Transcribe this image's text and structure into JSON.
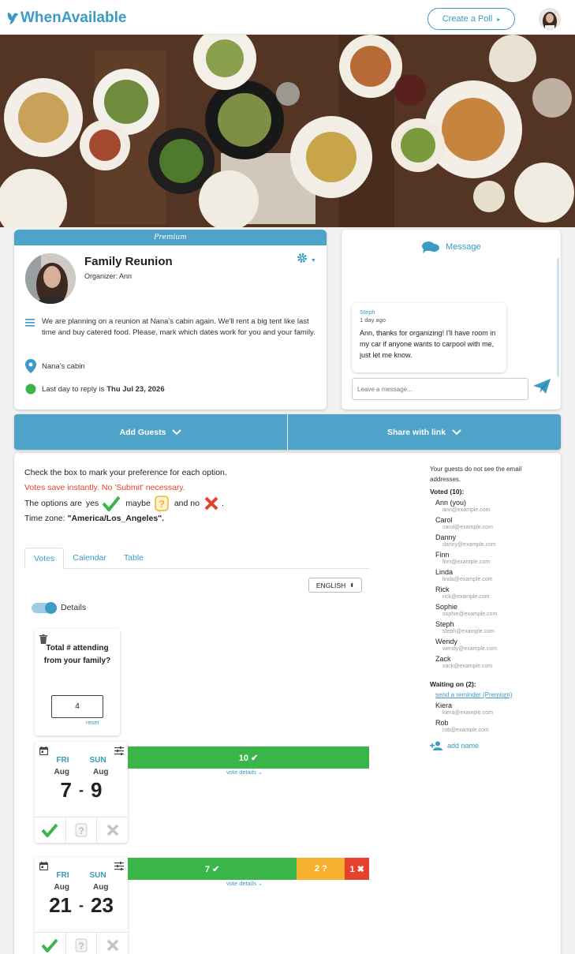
{
  "app": {
    "name": "WhenAvailable",
    "accent": "#3a9bc3"
  },
  "header": {
    "create_poll": "Create a Poll",
    "create_caret": "▸"
  },
  "event": {
    "premium": "Premium",
    "title": "Family Reunion",
    "organizer": "Organizer: Ann",
    "description": "We are planning on a reunion at Nana's cabin again. We'll rent a big tent like last time and buy catered food. Please, mark which dates work for you and your family.",
    "location": "Nana's cabin",
    "deadline_label": "Last day to reply is",
    "deadline_value": "Thu Jul 23, 2026"
  },
  "message": {
    "header": "Message",
    "sender": "Steph",
    "time": "1 day ago",
    "text": "Ann, thanks for organizing! I'll have room in my car if anyone wants to carpool with me, just let me know.",
    "input_placeholder": "Leave a message..."
  },
  "guest_bar": {
    "add_guests": "Add Guests",
    "share_link": "Share with link"
  },
  "instructions": {
    "line1": "Check the box to mark your preference for each option.",
    "line2": "Votes save instantly. No 'Submit' necessary.",
    "options_prefix": "The options are",
    "yes": "yes",
    "maybe": "maybe",
    "and_no": "and no",
    "period": ".",
    "tz_label": "Time zone:",
    "tz_value": "\"America/Los_Angeles\"."
  },
  "tabs": [
    "Votes",
    "Calendar",
    "Table"
  ],
  "language": {
    "value": "ENGLISH",
    "arrow": "⬍"
  },
  "details_toggle": {
    "label": "Details",
    "on": true
  },
  "attendance": {
    "question": "Total # attending from your family?",
    "value": "4",
    "reset": "reset"
  },
  "options": [
    {
      "start_day": "FRI",
      "end_day": "SUN",
      "start_month": "Aug",
      "end_month": "Aug",
      "start_date": "7",
      "end_date": "9",
      "dash": "-",
      "votes": {
        "yes": 10,
        "maybe": 0,
        "no": 0
      },
      "labels": {
        "yes": "10 ✔",
        "maybe": "",
        "no": ""
      },
      "vote_details": "vote details ⌄",
      "my_vote": "yes"
    },
    {
      "start_day": "FRI",
      "end_day": "SUN",
      "start_month": "Aug",
      "end_month": "Aug",
      "start_date": "21",
      "end_date": "23",
      "dash": "-",
      "votes": {
        "yes": 7,
        "maybe": 2,
        "no": 1
      },
      "labels": {
        "yes": "7 ✔",
        "maybe": "2 ?",
        "no": "1 ✖"
      },
      "vote_details": "vote details ⌄",
      "my_vote": "yes"
    }
  ],
  "guests": {
    "note": "Your guests do not see the email addresses.",
    "voted_header": "Voted (10):",
    "voted": [
      {
        "name": "Ann (you)",
        "email": "ann@example.com"
      },
      {
        "name": "Carol",
        "email": "carol@example.com"
      },
      {
        "name": "Danny",
        "email": "danny@example.com"
      },
      {
        "name": "Finn",
        "email": "finn@example.com"
      },
      {
        "name": "Linda",
        "email": "linda@example.com"
      },
      {
        "name": "Rick",
        "email": "rick@example.com"
      },
      {
        "name": "Sophie",
        "email": "sophie@example.com"
      },
      {
        "name": "Steph",
        "email": "steph@example.com"
      },
      {
        "name": "Wendy",
        "email": "wendy@example.com"
      },
      {
        "name": "Zack",
        "email": "zack@example.com"
      }
    ],
    "waiting_header": "Waiting on (2):",
    "reminder": "send a reminder (Premium)",
    "waiting": [
      {
        "name": "Kiera",
        "email": "kiera@example.com"
      },
      {
        "name": "Rob",
        "email": "rob@example.com"
      }
    ],
    "add_name": "add name"
  },
  "colors": {
    "yes": "#39b54a",
    "maybe": "#f6b02f",
    "no": "#e5412f",
    "bar": "#4fa3c9"
  }
}
